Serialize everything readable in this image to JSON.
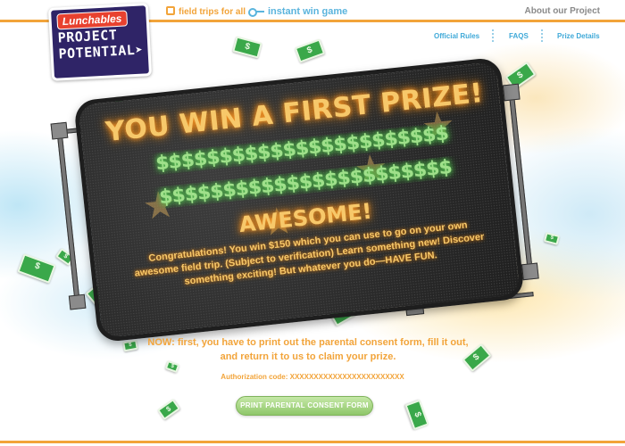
{
  "brand": {
    "logo_brand": "Lunchables",
    "logo_line1": "PROJECT",
    "logo_line2": "POTENTIAL"
  },
  "nav": {
    "field_trips": "field trips for all",
    "instant_win": "instant win game",
    "about": "About our Project"
  },
  "subnav": {
    "official_rules": "Official Rules",
    "faqs": "FAQS",
    "prize_details": "Prize Details"
  },
  "board": {
    "headline": "YOU WIN A FIRST PRIZE!",
    "dollars": "$$$$$$$$$$$$$$$$$$$$$$$",
    "awesome": "AWESOME!",
    "congrats": "Congratulations! You win $150 which you can use to go on your own awesome field trip. (Subject to verification) Learn something new! Discover something exciting! But whatever you do—HAVE FUN."
  },
  "instructions": {
    "now": "NOW:  first, you have to print out the parental consent form, fill it out, and return it to us to claim your prize.",
    "auth": "Authorization code:  XXXXXXXXXXXXXXXXXXXXXXXX"
  },
  "buttons": {
    "print": "PRINT PARENTAL CONSENT FORM"
  },
  "icons": {
    "field_trips": "bus-icon",
    "instant_win": "key-icon"
  },
  "colors": {
    "accent_orange": "#f2a43a",
    "accent_blue": "#5ab4dd",
    "money_green": "#3aa84a",
    "logo_purple": "#2f2467"
  }
}
